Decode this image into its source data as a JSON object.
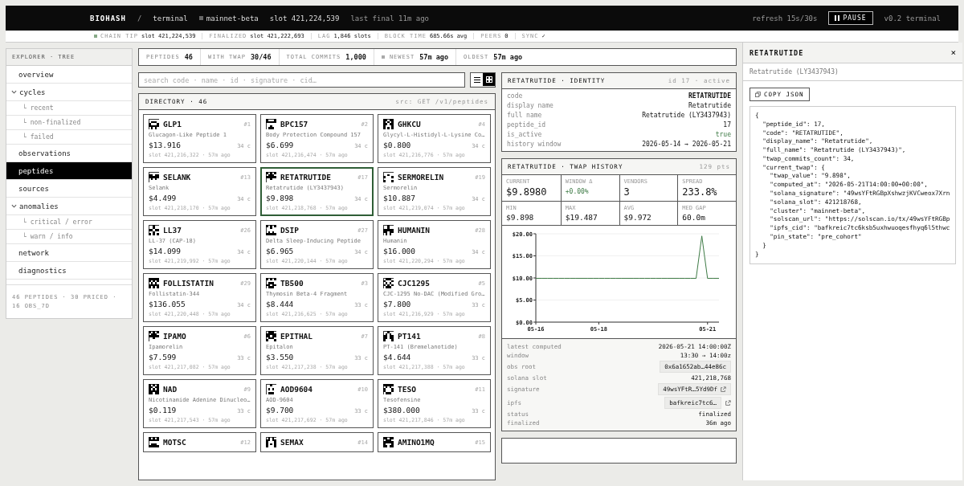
{
  "topbar": {
    "brand": "BIOHASH",
    "separator": "/",
    "section": "terminal",
    "network": "mainnet-beta",
    "slot": "slot 421,224,539",
    "last_final": "last final 11m ago",
    "refresh": "refresh 15s/30s",
    "pause_label": "PAUSE",
    "version": "v0.2 terminal"
  },
  "status_strip": [
    {
      "label": "CHAIN TIP",
      "value": "slot 421,224,539",
      "dot": true
    },
    {
      "label": "FINALIZED",
      "value": "slot 421,222,693",
      "dot": false
    },
    {
      "label": "LAG",
      "value": "1,846 slots",
      "dot": false
    },
    {
      "label": "BLOCK TIME",
      "value": "685.66s avg",
      "dot": false
    },
    {
      "label": "PEERS",
      "value": "0",
      "dot": false
    },
    {
      "label": "SYNC",
      "value": "✓",
      "dot": false
    }
  ],
  "sidebar": {
    "title": "EXPLORER · TREE",
    "items": [
      {
        "label": "overview",
        "selected": false
      },
      {
        "label": "cycles",
        "selected": false,
        "expanded": true,
        "children": [
          {
            "label": "└ recent",
            "selected": false
          },
          {
            "label": "└ non-finalized",
            "selected": false
          },
          {
            "label": "└ failed",
            "selected": false
          }
        ]
      },
      {
        "label": "observations",
        "selected": false
      },
      {
        "label": "peptides",
        "selected": true
      },
      {
        "label": "sources",
        "selected": false
      },
      {
        "label": "anomalies",
        "selected": false,
        "expanded": true,
        "children": [
          {
            "label": "└ critical / error",
            "selected": false
          },
          {
            "label": "└ warn / info",
            "selected": false
          }
        ]
      },
      {
        "label": "network",
        "selected": false
      },
      {
        "label": "diagnostics",
        "selected": false
      }
    ],
    "footer": "46 PEPTIDES · 30 PRICED · 16 OBS_7D"
  },
  "stats": [
    {
      "label": "PEPTIDES",
      "value": "46",
      "dot": false
    },
    {
      "label": "WITH TWAP",
      "value": "30/46",
      "dot": false
    },
    {
      "label": "TOTAL COMMITS",
      "value": "1,000",
      "dot": false
    },
    {
      "label": "NEWEST",
      "value": "57m ago",
      "dot": true
    },
    {
      "label": "OLDEST",
      "value": "57m ago",
      "dot": false
    }
  ],
  "search": {
    "placeholder": "search code · name · id · signature · cid…"
  },
  "view_toggle": [
    {
      "kind": "list",
      "selected": false
    },
    {
      "kind": "grid",
      "selected": true
    }
  ],
  "directory": {
    "title": "DIRECTORY · 46",
    "source": "src: GET /v1/peptides",
    "cards": [
      {
        "code": "GLP1",
        "number": "#1",
        "name": "Glucagon-Like Peptide 1",
        "price": "$13.916",
        "commits": "34 c",
        "slot": "slot 421,216,322 · 57m ago",
        "selected": false
      },
      {
        "code": "BPC157",
        "number": "#2",
        "name": "Body Protection Compound 157",
        "price": "$6.699",
        "commits": "34 c",
        "slot": "slot 421,216,474 · 57m ago",
        "selected": false
      },
      {
        "code": "GHKCU",
        "number": "#4",
        "name": "Glycyl-L-Histidyl-L-Lysine Co…",
        "price": "$0.800",
        "commits": "34 c",
        "slot": "slot 421,216,776 · 57m ago",
        "selected": false
      },
      {
        "code": "SELANK",
        "number": "#13",
        "name": "Selank",
        "price": "$4.499",
        "commits": "34 c",
        "slot": "slot 421,218,170 · 57m ago",
        "selected": false
      },
      {
        "code": "RETATRUTIDE",
        "number": "#17",
        "name": "Retatrutide (LY3437943)",
        "price": "$9.898",
        "commits": "34 c",
        "slot": "slot 421,218,768 · 57m ago",
        "selected": true
      },
      {
        "code": "SERMORELIN",
        "number": "#19",
        "name": "Sermorelin",
        "price": "$10.887",
        "commits": "34 c",
        "slot": "slot 421,219,074 · 57m ago",
        "selected": false
      },
      {
        "code": "LL37",
        "number": "#26",
        "name": "LL-37 (CAP-18)",
        "price": "$14.099",
        "commits": "34 c",
        "slot": "slot 421,219,992 · 57m ago",
        "selected": false
      },
      {
        "code": "DSIP",
        "number": "#27",
        "name": "Delta Sleep-Inducing Peptide",
        "price": "$6.965",
        "commits": "34 c",
        "slot": "slot 421,220,144 · 57m ago",
        "selected": false
      },
      {
        "code": "HUMANIN",
        "number": "#28",
        "name": "Humanin",
        "price": "$16.000",
        "commits": "34 c",
        "slot": "slot 421,220,294 · 57m ago",
        "selected": false
      },
      {
        "code": "FOLLISTATIN",
        "number": "#29",
        "name": "Follistatin-344",
        "price": "$136.055",
        "commits": "34 c",
        "slot": "slot 421,220,448 · 57m ago",
        "selected": false
      },
      {
        "code": "TB500",
        "number": "#3",
        "name": "Thymosin Beta-4 Fragment",
        "price": "$8.444",
        "commits": "33 c",
        "slot": "slot 421,216,625 · 57m ago",
        "selected": false
      },
      {
        "code": "CJC1295",
        "number": "#5",
        "name": "CJC-1295 No-DAC (Modified Gro…",
        "price": "$7.800",
        "commits": "33 c",
        "slot": "slot 421,216,929 · 57m ago",
        "selected": false
      },
      {
        "code": "IPAMO",
        "number": "#6",
        "name": "Ipamorelin",
        "price": "$7.599",
        "commits": "33 c",
        "slot": "slot 421,217,082 · 57m ago",
        "selected": false
      },
      {
        "code": "EPITHAL",
        "number": "#7",
        "name": "Epitalon",
        "price": "$3.550",
        "commits": "33 c",
        "slot": "slot 421,217,238 · 57m ago",
        "selected": false
      },
      {
        "code": "PT141",
        "number": "#8",
        "name": "PT-141 (Bremelanotide)",
        "price": "$4.644",
        "commits": "33 c",
        "slot": "slot 421,217,388 · 57m ago",
        "selected": false
      },
      {
        "code": "NAD",
        "number": "#9",
        "name": "Nicotinamide Adenine Dinucleo…",
        "price": "$0.119",
        "commits": "33 c",
        "slot": "slot 421,217,543 · 57m ago",
        "selected": false
      },
      {
        "code": "AOD9604",
        "number": "#10",
        "name": "AOD-9604",
        "price": "$9.700",
        "commits": "33 c",
        "slot": "slot 421,217,692 · 57m ago",
        "selected": false
      },
      {
        "code": "TESO",
        "number": "#11",
        "name": "Tesofensine",
        "price": "$380.000",
        "commits": "33 c",
        "slot": "slot 421,217,846 · 57m ago",
        "selected": false
      },
      {
        "code": "MOTSC",
        "number": "#12",
        "selected": false
      },
      {
        "code": "SEMAX",
        "number": "#14",
        "selected": false
      },
      {
        "code": "AMINO1MQ",
        "number": "#15",
        "selected": false
      }
    ]
  },
  "identity": {
    "title": "RETATRUTIDE · IDENTITY",
    "meta": "id 17 · active",
    "rows": [
      {
        "label": "code",
        "value": "RETATRUTIDE",
        "kind": "bold"
      },
      {
        "label": "display name",
        "value": "Retatrutide",
        "kind": "plain"
      },
      {
        "label": "full name",
        "value": "Retatrutide (LY3437943)",
        "kind": "plain"
      },
      {
        "label": "peptide_id",
        "value": "17",
        "kind": "plain"
      },
      {
        "label": "is_active",
        "value": "true",
        "kind": "positive"
      },
      {
        "label": "history window",
        "value": "2026-05-14 → 2026-05-21",
        "kind": "plain"
      }
    ]
  },
  "twap": {
    "title": "RETATRUTIDE · TWAP HISTORY",
    "meta": "129 pts",
    "primary_stats": [
      {
        "label": "CURRENT",
        "value": "$9.8980",
        "positive": false
      },
      {
        "label": "WINDOW Δ",
        "value": "+0.00%",
        "positive": true
      },
      {
        "label": "VENDORS",
        "value": "3",
        "positive": false
      },
      {
        "label": "SPREAD",
        "value": "233.8%",
        "positive": false
      }
    ],
    "secondary_stats": [
      {
        "label": "MIN",
        "value": "$9.898"
      },
      {
        "label": "MAX",
        "value": "$19.487"
      },
      {
        "label": "AVG",
        "value": "$9.972"
      },
      {
        "label": "MED GAP",
        "value": "60.0m"
      }
    ],
    "chart_data": {
      "type": "line",
      "ylim": [
        0,
        20
      ],
      "categories": [
        "05-16",
        null,
        null,
        null,
        null,
        null,
        null,
        null,
        null,
        null,
        null,
        "05-18",
        null,
        null,
        null,
        null,
        null,
        null,
        null,
        null,
        null,
        null,
        null,
        null,
        null,
        null,
        null,
        null,
        null,
        null,
        "05-21",
        null,
        null
      ],
      "yticks": [
        {
          "value": 0,
          "label": "$0.00"
        },
        {
          "value": 5,
          "label": "$5.00"
        },
        {
          "value": 10,
          "label": "$10.00"
        },
        {
          "value": 15,
          "label": "$15.00"
        },
        {
          "value": 20,
          "label": "$20.00"
        }
      ],
      "series": [
        {
          "color": "#3d7a45",
          "values": [
            9.9,
            9.9,
            9.9,
            9.9,
            9.9,
            9.9,
            9.9,
            9.9,
            9.9,
            9.9,
            9.9,
            9.9,
            9.9,
            9.9,
            9.9,
            9.9,
            9.9,
            9.9,
            9.9,
            9.9,
            9.9,
            9.9,
            9.9,
            9.9,
            9.9,
            9.9,
            9.9,
            9.9,
            9.9,
            19.5,
            9.9,
            9.9,
            9.9
          ]
        }
      ],
      "grid": true
    },
    "details": [
      {
        "label": "latest computed",
        "value": "2026-05-21 14:00:00Z",
        "kind": "text"
      },
      {
        "label": "window",
        "value": "13:30 → 14:00z",
        "kind": "text"
      },
      {
        "label": "obs root",
        "value": "0x6a1652ab…44e86c",
        "kind": "chip"
      },
      {
        "label": "solana slot",
        "value": "421,218,768",
        "kind": "text"
      },
      {
        "label": "signature",
        "value": "49wsYFtR…5Yd9Df",
        "kind": "chip-link"
      },
      {
        "label": "ipfs",
        "value": "bafkreic7tc6…",
        "kind": "chip-external"
      },
      {
        "label": "status",
        "value": "finalized",
        "kind": "text"
      },
      {
        "label": "finalized",
        "value": "36m ago",
        "kind": "text"
      }
    ]
  },
  "inspector": {
    "title": "RETATRUTIDE",
    "close": "×",
    "subtitle": "Retatrutide (LY3437943)",
    "copy_label": "COPY JSON",
    "json_lines": [
      "{",
      "  \"peptide_id\": 17,",
      "  \"code\": \"RETATRUTIDE\",",
      "  \"display_name\": \"Retatrutide\",",
      "  \"full_name\": \"Retatrutide (LY3437943)\",",
      "  \"twap_commits_count\": 34,",
      "  \"current_twap\": {",
      "    \"twap_value\": \"9.898\",",
      "    \"computed_at\": \"2026-05-21T14:00:00+00:00\",",
      "    \"solana_signature\": \"49wsYFtRGBpXshwzjKVCweox7Xrn",
      "    \"solana_slot\": 421218768,",
      "    \"cluster\": \"mainnet-beta\",",
      "    \"solscan_url\": \"https://solscan.io/tx/49wsYFtRGBp",
      "    \"ipfs_cid\": \"bafkreic7tc6ksb5uxhwuoqesfhyq6l5thwc",
      "    \"pin_state\": \"pre_cohort\"",
      "  }",
      "}"
    ]
  }
}
